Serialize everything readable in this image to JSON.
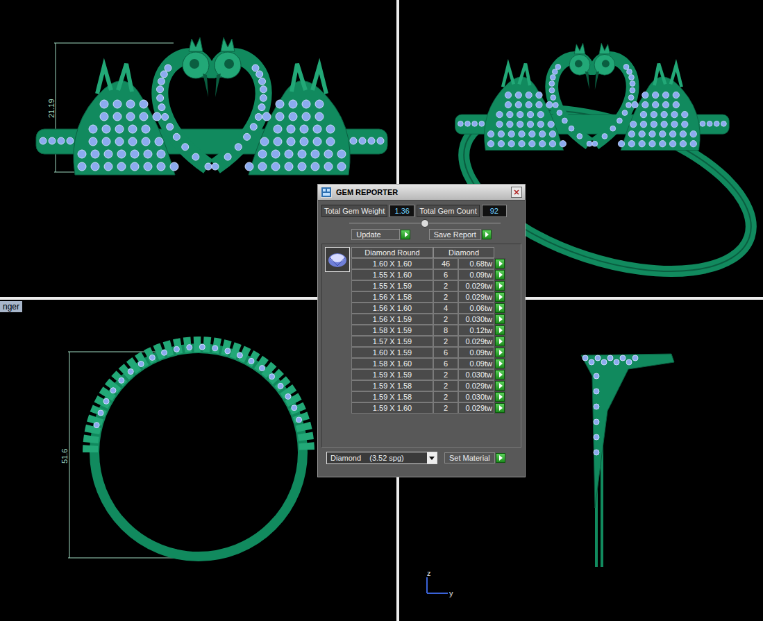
{
  "viewports": {
    "front": {
      "dimension": "21.19"
    },
    "side": {
      "label": "nger",
      "dimension": "51.6"
    },
    "right": {
      "axes": [
        "z",
        "y"
      ]
    }
  },
  "gem_reporter": {
    "title": "GEM REPORTER",
    "total_weight": {
      "label": "Total Gem Weight",
      "value": "1.36"
    },
    "total_count": {
      "label": "Total Gem Count",
      "value": "92"
    },
    "slider": {
      "level": 0.5
    },
    "buttons": [
      {
        "label": "Update"
      },
      {
        "label": "Save Report"
      }
    ],
    "columns": [
      "Diamond Round",
      "Diamond"
    ],
    "rows": [
      {
        "size": "1.60 X 1.60",
        "count": "46",
        "weight": "0.68tw"
      },
      {
        "size": "1.55 X 1.60",
        "count": "6",
        "weight": "0.09tw"
      },
      {
        "size": "1.55 X 1.59",
        "count": "2",
        "weight": "0.029tw"
      },
      {
        "size": "1.56 X 1.58",
        "count": "2",
        "weight": "0.029tw"
      },
      {
        "size": "1.56 X 1.60",
        "count": "4",
        "weight": "0.06tw"
      },
      {
        "size": "1.56 X 1.59",
        "count": "2",
        "weight": "0.030tw"
      },
      {
        "size": "1.58 X 1.59",
        "count": "8",
        "weight": "0.12tw"
      },
      {
        "size": "1.57 X 1.59",
        "count": "2",
        "weight": "0.029tw"
      },
      {
        "size": "1.60 X 1.59",
        "count": "6",
        "weight": "0.09tw"
      },
      {
        "size": "1.58 X 1.60",
        "count": "6",
        "weight": "0.09tw"
      },
      {
        "size": "1.59 X 1.59",
        "count": "2",
        "weight": "0.030tw"
      },
      {
        "size": "1.59 X 1.58",
        "count": "2",
        "weight": "0.029tw"
      },
      {
        "size": "1.59 X 1.58",
        "count": "2",
        "weight": "0.030tw"
      },
      {
        "size": "1.59 X 1.60",
        "count": "2",
        "weight": "0.029tw"
      }
    ],
    "material": {
      "value": "Diamond    (3.52 spg)"
    },
    "set_material": {
      "label": "Set Material"
    }
  }
}
